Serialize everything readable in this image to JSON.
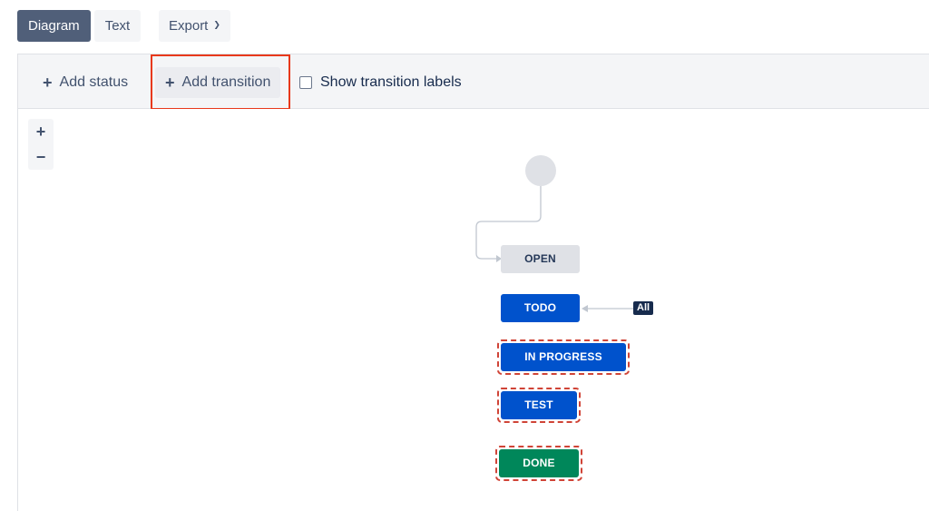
{
  "view_tabs": [
    {
      "label": "Diagram",
      "active": true
    },
    {
      "label": "Text",
      "active": false
    }
  ],
  "export": {
    "label": "Export",
    "icon": "chevron-down-icon"
  },
  "toolbar": {
    "add_status_label": "Add status",
    "add_transition_label": "Add transition",
    "show_labels_text": "Show transition labels",
    "show_labels_checked": false
  },
  "zoom": {
    "in": "+",
    "out": "−"
  },
  "statuses": {
    "open": "OPEN",
    "todo": "TODO",
    "in_progress": "IN PROGRESS",
    "test": "TEST",
    "done": "DONE"
  },
  "global_transition": {
    "label": "All",
    "target": "TODO"
  },
  "colors": {
    "active_tab": "#505f79",
    "highlight": "#e8391b",
    "status_blue": "#0052cc",
    "status_green": "#00875a",
    "status_grey": "#dfe1e6",
    "dashed_ring": "#d04437"
  }
}
